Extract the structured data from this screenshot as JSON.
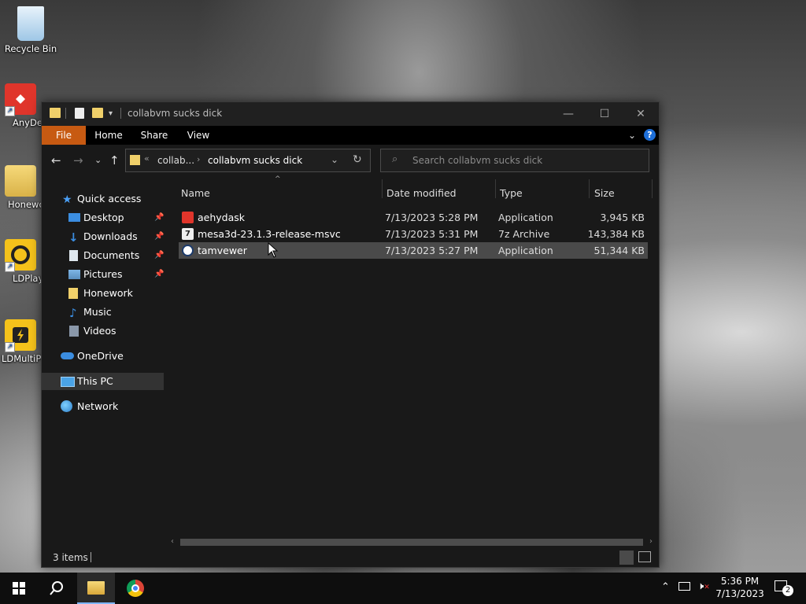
{
  "desktop": {
    "icons": [
      {
        "label": "Recycle Bin"
      },
      {
        "label": "AnyDe"
      },
      {
        "label": "Honewo"
      },
      {
        "label": "LDPlay"
      },
      {
        "label": "LDMultiP"
      }
    ]
  },
  "window": {
    "title": "collabvm sucks dick",
    "ribbon_tabs": [
      "File",
      "Home",
      "Share",
      "View"
    ],
    "address": {
      "parent": "collab...",
      "current": "collabvm sucks dick"
    },
    "search_placeholder": "Search collabvm sucks dick",
    "sidebar": {
      "items": [
        {
          "label": "Quick access",
          "icon": "star-icon"
        },
        {
          "label": "Desktop",
          "icon": "desktop-icon",
          "pinned": true
        },
        {
          "label": "Downloads",
          "icon": "download-icon",
          "pinned": true
        },
        {
          "label": "Documents",
          "icon": "document-icon",
          "pinned": true
        },
        {
          "label": "Pictures",
          "icon": "pictures-icon",
          "pinned": true
        },
        {
          "label": "Honework",
          "icon": "folder-icon"
        },
        {
          "label": "Music",
          "icon": "music-icon"
        },
        {
          "label": "Videos",
          "icon": "video-icon"
        },
        {
          "label": "OneDrive",
          "icon": "cloud-icon"
        },
        {
          "label": "This PC",
          "icon": "computer-icon",
          "selected": true
        },
        {
          "label": "Network",
          "icon": "network-icon"
        }
      ]
    },
    "columns": [
      "Name",
      "Date modified",
      "Type",
      "Size"
    ],
    "files": [
      {
        "name": "aehydask",
        "date": "7/13/2023 5:28 PM",
        "type": "Application",
        "size": "3,945 KB",
        "icon": "anydesk-app-icon",
        "color": "#e0352b"
      },
      {
        "name": "mesa3d-23.1.3-release-msvc",
        "date": "7/13/2023 5:31 PM",
        "type": "7z Archive",
        "size": "143,384 KB",
        "icon": "archive-icon",
        "color": "#eeeeee"
      },
      {
        "name": "tamvewer",
        "date": "7/13/2023 5:27 PM",
        "type": "Application",
        "size": "51,344 KB",
        "icon": "teamviewer-app-icon",
        "color": "#ffffff",
        "selected": true
      }
    ],
    "status": "3 items"
  },
  "taskbar": {
    "time": "5:36 PM",
    "date": "7/13/2023",
    "notification_count": "2"
  },
  "colors": {
    "file_tab": "#c75a12",
    "help_blue": "#1e6fd9"
  }
}
